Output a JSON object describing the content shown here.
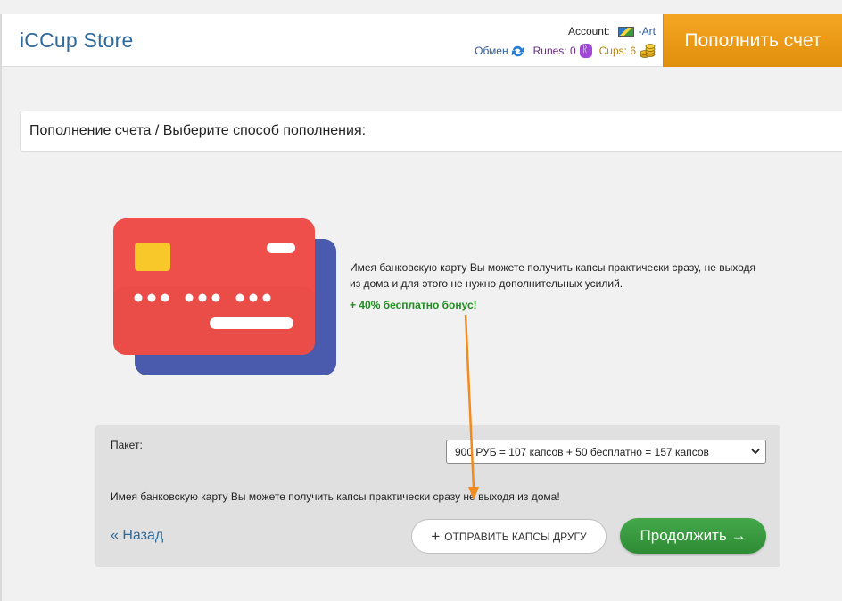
{
  "header": {
    "logo": "iCCup Store",
    "account_label": "Account:",
    "account_name": "-Art",
    "exchange_label": "Обмен",
    "runes_label": "Runes: 0",
    "cups_label": "Cups: 6",
    "topup_label": "Пополнить счет"
  },
  "breadcrumb": {
    "text": "Пополнение счета / Выберите способ пополнения:"
  },
  "method": {
    "description": "Имея банковскую карту Вы можете получить капсы практически сразу, не выходя из дома и для этого не нужно дополнительных усилий.",
    "bonus": "+ 40% бесплатно бонус!"
  },
  "panel": {
    "package_label": "Пакет:",
    "package_selected": "900 РУБ = 107 капсов + 50 бесплатно = 157 капсов",
    "note": "Имея банковскую карту Вы можете получить капсы практически сразу не выходя из дома!",
    "back_label": "« Назад",
    "send_label": "ОТПРАВИТЬ КАПСЫ ДРУГУ",
    "continue_label": "Продолжить →"
  },
  "colors": {
    "brand_blue": "#2f6a9b",
    "topup_orange": "#f5a623",
    "continue_green": "#3a9a40",
    "bonus_green": "#1e8f1e",
    "annotation_arrow": "#f28a1e"
  }
}
